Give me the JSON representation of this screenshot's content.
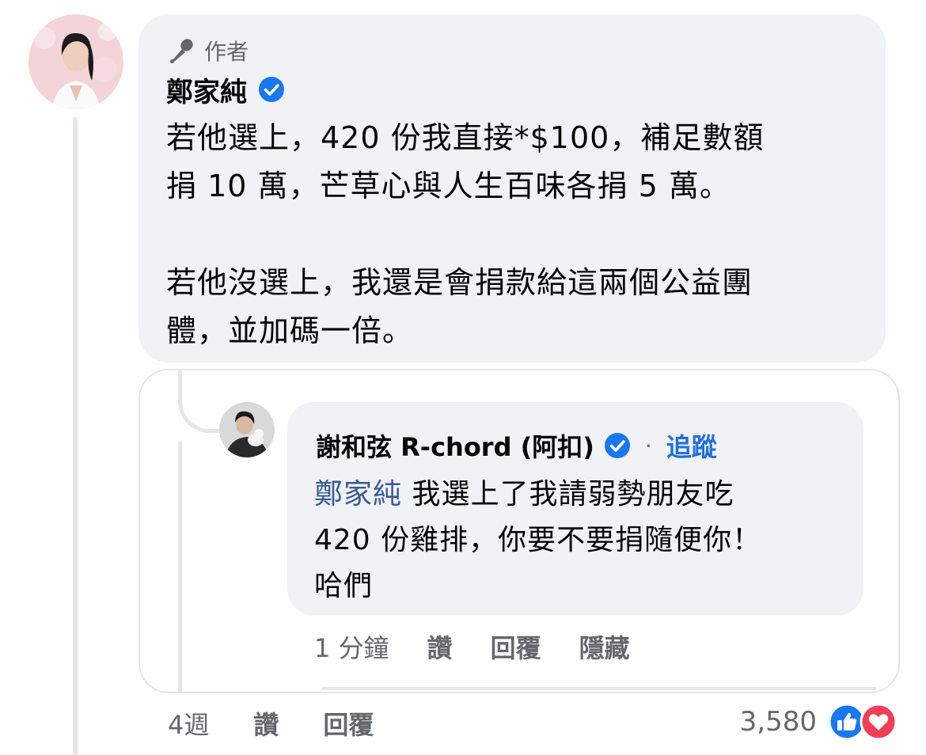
{
  "comment": {
    "author_badge": "作者",
    "author_name": "鄭家純",
    "text_lines": [
      "若他選上，420 份我直接*$100，補足數額",
      "捐 10 萬，芒草心與人生百味各捐 5 萬。",
      "若他沒選上，我還是會捐款給這兩個公益團",
      "體，並加碼一倍。"
    ],
    "actions": {
      "time": "4週",
      "like": "讚",
      "reply": "回覆"
    },
    "reaction_count": "3,580"
  },
  "embedded_reply": {
    "author_name": "謝和弦 R-chord (阿扣)",
    "separator": "·",
    "follow_label": "追蹤",
    "mention": "鄭家純",
    "text_line_1": "我選上了我請弱勢朋友吃",
    "text_line_2": "420 份雞排，你要不要捐隨便你！",
    "text_line_3": "哈們",
    "actions": {
      "time": "1 分鐘",
      "like": "讚",
      "reply": "回覆",
      "hide": "隱藏"
    }
  },
  "icons": {
    "badge": "microphone-icon",
    "verified": "verified-badge-icon",
    "like_reaction": "like-reaction-icon",
    "love_reaction": "love-reaction-icon"
  },
  "colors": {
    "bubble": "#f0f2f5",
    "verified": "#1877f2",
    "follow": "#216fdb",
    "mention": "#385898",
    "like": "#1877f2",
    "love": "#f33e58"
  }
}
